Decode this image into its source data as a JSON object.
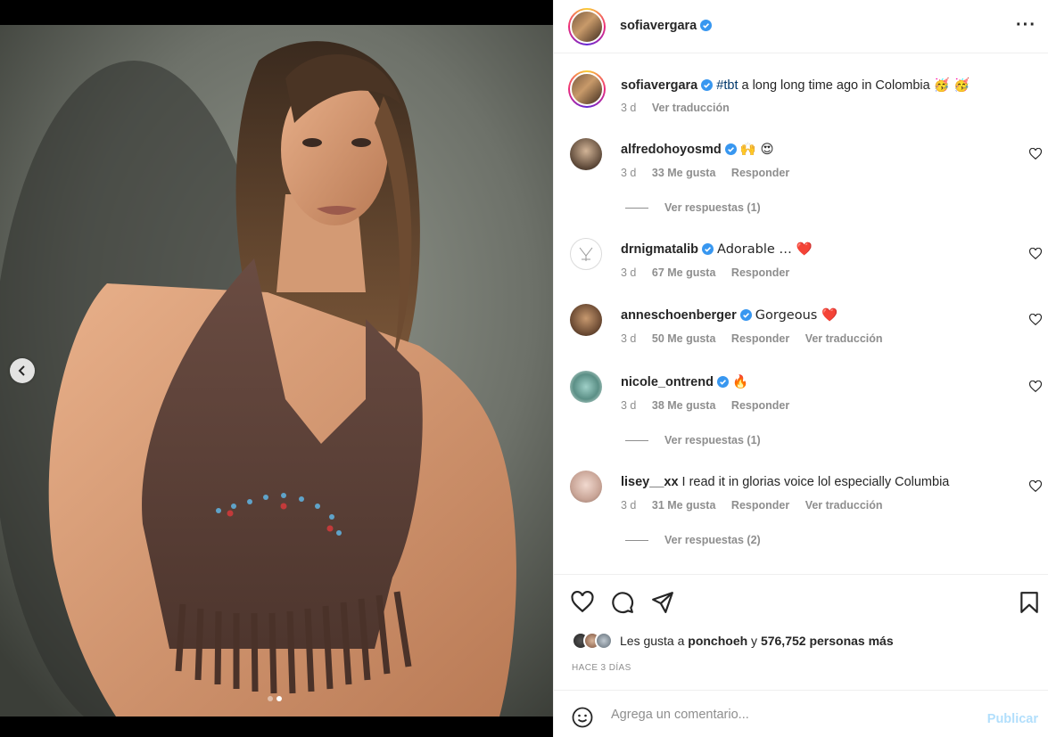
{
  "media": {
    "slide_count": 2,
    "active_slide": 2
  },
  "header": {
    "username": "sofiavergara",
    "more_label": "···"
  },
  "caption": {
    "username": "sofiavergara",
    "hashtag": "#tbt",
    "text": " a long long time ago in Colombia",
    "emoji": "🥳 🥳",
    "time": "3 d",
    "translate": "Ver traducción"
  },
  "comments": [
    {
      "username": "alfredohoyosmd",
      "verified": true,
      "text": "🙌 😍",
      "time": "3 d",
      "likes": "33 Me gusta",
      "reply": "Responder",
      "translate": "",
      "view_replies": "Ver respuestas (1)"
    },
    {
      "username": "drnigmatalib",
      "verified": true,
      "text": "Adorable … ❤️",
      "time": "3 d",
      "likes": "67 Me gusta",
      "reply": "Responder",
      "translate": "",
      "view_replies": ""
    },
    {
      "username": "anneschoenberger",
      "verified": true,
      "text": "Gorgeous ❤️",
      "time": "3 d",
      "likes": "50 Me gusta",
      "reply": "Responder",
      "translate": "Ver traducción",
      "view_replies": ""
    },
    {
      "username": "nicole_ontrend",
      "verified": true,
      "text": "🔥",
      "time": "3 d",
      "likes": "38 Me gusta",
      "reply": "Responder",
      "translate": "",
      "view_replies": "Ver respuestas (1)"
    },
    {
      "username": "lisey__xx",
      "verified": false,
      "text": "I read it in glorias voice lol especially Columbia",
      "time": "3 d",
      "likes": "31 Me gusta",
      "reply": "Responder",
      "translate": "Ver traducción",
      "view_replies": "Ver respuestas (2)"
    }
  ],
  "actions": {
    "likes_prefix": "Les gusta a ",
    "liked_by": "ponchoeh",
    "likes_middle": " y ",
    "likes_count": "576,752 personas más",
    "date": "HACE 3 DÍAS"
  },
  "composer": {
    "placeholder": "Agrega un comentario...",
    "publish": "Publicar"
  },
  "colors": {
    "verified": "#3897f0",
    "heart_red": "#ed4956",
    "publish_disabled": "#b2dffc",
    "muted": "#8e8e8e"
  }
}
